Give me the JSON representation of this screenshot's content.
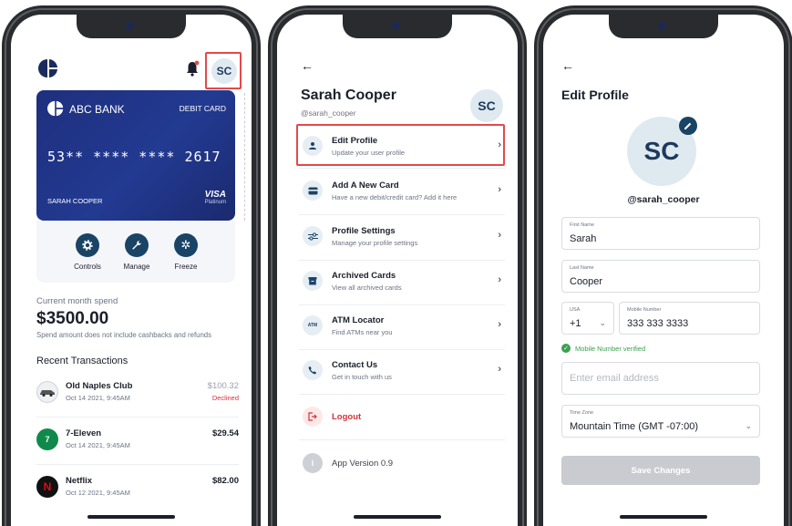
{
  "colors": {
    "highlight": "#e24a4a",
    "card_blue": "#223a91",
    "control_navy": "#1a4466",
    "declined_red": "#d9303a",
    "verified_green": "#3aa14d",
    "disabled_button": "#c9cbd0"
  },
  "dashboard": {
    "avatar_initials": "SC",
    "notification_icon": "bell-icon",
    "card": {
      "bank_name": "ABC BANK",
      "card_type": "DEBIT CARD",
      "number": "53** **** **** 2617",
      "holder": "SARAH COOPER",
      "network": "VISA",
      "tier": "Platinum"
    },
    "controls": [
      {
        "label": "Controls",
        "icon": "gear-icon"
      },
      {
        "label": "Manage",
        "icon": "wrench-icon"
      },
      {
        "label": "Freeze",
        "icon": "snowflake-icon"
      }
    ],
    "spend": {
      "label": "Current month spend",
      "amount": "$3500.00",
      "note": "Spend amount does not include cashbacks and refunds"
    },
    "recent_title": "Recent Transactions",
    "transactions": [
      {
        "name": "Old Naples Club",
        "date": "Oct 14 2021, 9:45AM",
        "amount": "$100.32",
        "status": "Declined",
        "icon": "car-icon"
      },
      {
        "name": "7-Eleven",
        "date": "Oct 14 2021, 9:45AM",
        "amount": "$29.54",
        "status": "",
        "icon": "seven-eleven-logo-icon"
      },
      {
        "name": "Netflix",
        "date": "Oct 12 2021, 9:45AM",
        "amount": "$82.00",
        "status": "",
        "icon": "netflix-logo-icon"
      }
    ]
  },
  "profile_menu": {
    "back_icon": "back-arrow-icon",
    "name": "Sarah Cooper",
    "handle": "@sarah_cooper",
    "avatar_initials": "SC",
    "items": [
      {
        "title": "Edit Profile",
        "subtitle": "Update your user profile",
        "icon": "user-icon"
      },
      {
        "title": "Add A New Card",
        "subtitle": "Have a new debit/credit card? Add it here",
        "icon": "card-icon"
      },
      {
        "title": "Profile Settings",
        "subtitle": "Manage your profile settings",
        "icon": "sliders-icon"
      },
      {
        "title": "Archived Cards",
        "subtitle": "View all archived cards",
        "icon": "archive-icon"
      },
      {
        "title": "ATM Locator",
        "subtitle": "Find ATMs near you",
        "icon": "atm-icon"
      },
      {
        "title": "Contact Us",
        "subtitle": "Get in touch with us",
        "icon": "phone-icon"
      }
    ],
    "logout_label": "Logout",
    "atm_icon_text": "ATM",
    "version_label": "App Version 0.9"
  },
  "edit_profile": {
    "back_icon": "back-arrow-icon",
    "title": "Edit Profile",
    "avatar_initials": "SC",
    "handle": "@sarah_cooper",
    "first_name": {
      "label": "First Name",
      "value": "Sarah"
    },
    "last_name": {
      "label": "Last Name",
      "value": "Cooper"
    },
    "country_code": {
      "label": "USA",
      "value": "+1"
    },
    "mobile": {
      "label": "Mobile Number",
      "value": "333 333 3333"
    },
    "verified_text": "Mobile Number verified",
    "email": {
      "placeholder": "Enter email address"
    },
    "timezone": {
      "label": "Time Zone",
      "value": "Mountain Time (GMT -07:00)"
    },
    "save_label": "Save Changes"
  }
}
